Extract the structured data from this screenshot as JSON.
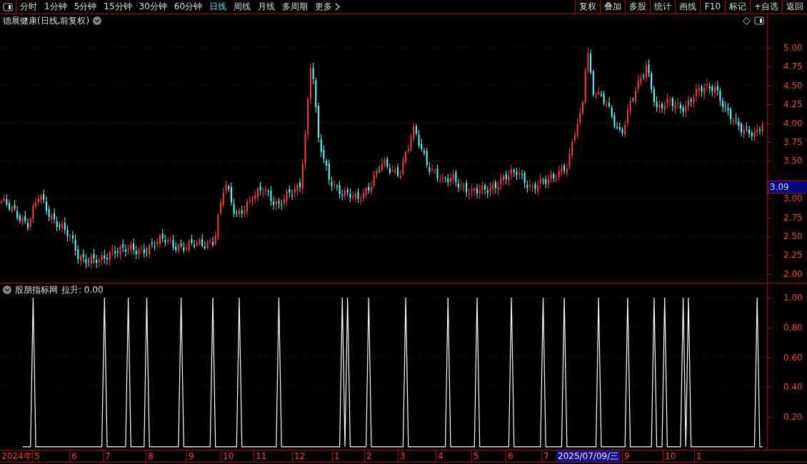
{
  "toolbar": {
    "periods": [
      {
        "label": "分时",
        "selected": false
      },
      {
        "label": "1分钟",
        "selected": false
      },
      {
        "label": "5分钟",
        "selected": false
      },
      {
        "label": "15分钟",
        "selected": false
      },
      {
        "label": "30分钟",
        "selected": false
      },
      {
        "label": "60分钟",
        "selected": false
      },
      {
        "label": "日线",
        "selected": true
      },
      {
        "label": "周线",
        "selected": false
      },
      {
        "label": "月线",
        "selected": false
      },
      {
        "label": "多周期",
        "selected": false
      }
    ],
    "more": "更多",
    "actions": [
      "复权",
      "叠加",
      "多股",
      "统计",
      "画线",
      "F10",
      "标记",
      "+自选",
      "返回"
    ]
  },
  "main_panel": {
    "title": "德展健康(日线,前复权)",
    "price_axis": [
      "5.00",
      "4.75",
      "4.50",
      "4.25",
      "4.00",
      "3.75",
      "3.50",
      "3.00",
      "2.75",
      "2.50",
      "2.25",
      "2.00"
    ],
    "current_price": "3.09"
  },
  "indicator_panel": {
    "title": "股朋指标网",
    "reading": "拉升: 0.00",
    "chart_data": {
      "type": "line",
      "ylim": [
        -0.02,
        1.01
      ],
      "grid": true,
      "yticks": [
        {
          "value": 1,
          "label": "1.00"
        },
        {
          "value": 0.8,
          "label": "0.80"
        },
        {
          "value": 0.6,
          "label": "0.60"
        },
        {
          "value": 0.4,
          "label": "0.40"
        },
        {
          "value": 0.2,
          "label": "0.20"
        }
      ],
      "series": [
        {
          "color": "#ffffff",
          "values": [
            null,
            null,
            null,
            null,
            null,
            null,
            null,
            null,
            0,
            0,
            0,
            0,
            1,
            0,
            0,
            0,
            0,
            0,
            0,
            0,
            0,
            0,
            0,
            0,
            0,
            0,
            0,
            0,
            0,
            0,
            0,
            0,
            0,
            0,
            0,
            0,
            0,
            0,
            0,
            1,
            0,
            0,
            0,
            0,
            0,
            0,
            0,
            0,
            1,
            0,
            0,
            0,
            0,
            0,
            0,
            1,
            0,
            0,
            0,
            0,
            0,
            0,
            0,
            0,
            0,
            0,
            0,
            0,
            1,
            0,
            0,
            0,
            0,
            0,
            0,
            0,
            0,
            0,
            0,
            0,
            1,
            0,
            0,
            0,
            0,
            0,
            0,
            0,
            0,
            0,
            1,
            0,
            0,
            0,
            0,
            0,
            0,
            0,
            0,
            0,
            0,
            0,
            0,
            0,
            0,
            1,
            0,
            0,
            0,
            0,
            0,
            0,
            0,
            0,
            0,
            0,
            0,
            0,
            0,
            0,
            0,
            0,
            0,
            0,
            0,
            0,
            0,
            0,
            0,
            1,
            0,
            1,
            0,
            0,
            0,
            0,
            0,
            0,
            0,
            1,
            0,
            0,
            0,
            0,
            0,
            0,
            0,
            0,
            0,
            0,
            0,
            0,
            0,
            1,
            0,
            0,
            0,
            0,
            0,
            0,
            0,
            0,
            0,
            0,
            0,
            0,
            0,
            0,
            0,
            1,
            0,
            0,
            0,
            0,
            0,
            0,
            0,
            0,
            0,
            0,
            1,
            0,
            0,
            0,
            0,
            0,
            0,
            0,
            0,
            0,
            0,
            0,
            0,
            1,
            0,
            0,
            0,
            0,
            0,
            0,
            0,
            0,
            0,
            0,
            0,
            1,
            0,
            0,
            0,
            0,
            0,
            0,
            0,
            1,
            0,
            0,
            0,
            0,
            0,
            0,
            0,
            0,
            0,
            0,
            0,
            0,
            1,
            0,
            0,
            0,
            0,
            0,
            0,
            0,
            0,
            0,
            0,
            1,
            0,
            0,
            0,
            0,
            0,
            0,
            0,
            0,
            0,
            1,
            0,
            0,
            0,
            1,
            0,
            0,
            0,
            0,
            0,
            0,
            1,
            0,
            1,
            0,
            0,
            0,
            0,
            0,
            0,
            0,
            0,
            0,
            0,
            0,
            0,
            0,
            0,
            0,
            0,
            0,
            0,
            0,
            0,
            0,
            0,
            0,
            0,
            0,
            1,
            0,
            0
          ]
        }
      ]
    }
  },
  "date_axis": {
    "labels": [
      "2024年",
      "5",
      "6",
      "7",
      "8",
      "9",
      "10",
      "11",
      "12",
      "1",
      "2",
      "3",
      "4",
      "5",
      "6",
      "7",
      "9",
      "10",
      "1"
    ],
    "cursor_date": "2025/07/09/三"
  }
}
